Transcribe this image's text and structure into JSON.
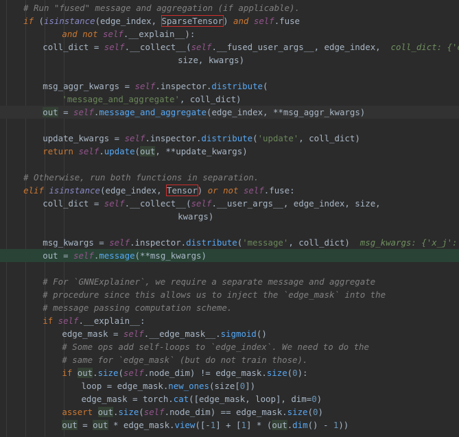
{
  "editor": {
    "language": "Python",
    "theme_colors": {
      "background": "#2b2b2b",
      "keyword": "#cc7832",
      "comment": "#808080",
      "string": "#6a8759",
      "self": "#94558d",
      "method": "#56a8f5",
      "number": "#6897bb",
      "highlight_box": "#d42e2e",
      "current_line": "#294436"
    },
    "lines": [
      {
        "indent": 4,
        "bg": "",
        "tokens": [
          [
            "cmt",
            "# Run \"fused\" message and aggregation (if applicable)."
          ]
        ]
      },
      {
        "indent": 4,
        "bg": "",
        "tokens": [
          [
            "kw",
            "if"
          ],
          [
            "p",
            " ("
          ],
          [
            "bi",
            "isinstance"
          ],
          [
            "p",
            "(edge_index, "
          ],
          [
            "box",
            "SparseTensor"
          ],
          [
            "p",
            ") "
          ],
          [
            "kw",
            "and"
          ],
          [
            "p",
            " "
          ],
          [
            "slf",
            "self"
          ],
          [
            "p",
            ".fuse"
          ]
        ]
      },
      {
        "indent": 12,
        "bg": "",
        "tokens": [
          [
            "kw",
            "and not"
          ],
          [
            "p",
            " "
          ],
          [
            "slf",
            "self"
          ],
          [
            "p",
            ".__explain__):"
          ]
        ]
      },
      {
        "indent": 8,
        "bg": "",
        "tokens": [
          [
            "p",
            "coll_dict = "
          ],
          [
            "slf",
            "self"
          ],
          [
            "p",
            ".__collect__("
          ],
          [
            "slf",
            "self"
          ],
          [
            "p",
            ".__fused_user_args__, edge_index,  "
          ],
          [
            "hint",
            "coll_dict: {'edge_w"
          ]
        ]
      },
      {
        "indent": 36,
        "bg": "",
        "tokens": [
          [
            "p",
            "size, kwargs)"
          ]
        ]
      },
      {
        "indent": 0,
        "bg": "",
        "tokens": []
      },
      {
        "indent": 8,
        "bg": "",
        "tokens": [
          [
            "p",
            "msg_aggr_kwargs = "
          ],
          [
            "slf",
            "self"
          ],
          [
            "p",
            ".inspector."
          ],
          [
            "mth",
            "distribute"
          ],
          [
            "p",
            "("
          ]
        ]
      },
      {
        "indent": 12,
        "bg": "",
        "tokens": [
          [
            "str",
            "'message_and_aggregate'"
          ],
          [
            "p",
            ", coll_dict)"
          ]
        ]
      },
      {
        "indent": 8,
        "bg": "gray",
        "tokens": [
          [
            "ref",
            "out"
          ],
          [
            "p",
            " = "
          ],
          [
            "slf",
            "self"
          ],
          [
            "p",
            "."
          ],
          [
            "mth",
            "message_and_aggregate"
          ],
          [
            "p",
            "(edge_index, **msg_aggr_kwargs)"
          ]
        ]
      },
      {
        "indent": 0,
        "bg": "",
        "tokens": []
      },
      {
        "indent": 8,
        "bg": "",
        "tokens": [
          [
            "p",
            "update_kwargs = "
          ],
          [
            "slf",
            "self"
          ],
          [
            "p",
            ".inspector."
          ],
          [
            "mth",
            "distribute"
          ],
          [
            "p",
            "("
          ],
          [
            "str",
            "'update'"
          ],
          [
            "p",
            ", coll_dict)"
          ]
        ]
      },
      {
        "indent": 8,
        "bg": "",
        "tokens": [
          [
            "kwn",
            "return"
          ],
          [
            "p",
            " "
          ],
          [
            "slf",
            "self"
          ],
          [
            "p",
            "."
          ],
          [
            "mth",
            "update"
          ],
          [
            "p",
            "("
          ],
          [
            "ref",
            "out"
          ],
          [
            "p",
            ", **update_kwargs)"
          ]
        ]
      },
      {
        "indent": 0,
        "bg": "",
        "tokens": []
      },
      {
        "indent": 4,
        "bg": "",
        "tokens": [
          [
            "cmt",
            "# Otherwise, run both functions in separation."
          ]
        ]
      },
      {
        "indent": 4,
        "bg": "",
        "tokens": [
          [
            "kw",
            "elif"
          ],
          [
            "p",
            " "
          ],
          [
            "bi",
            "isinstance"
          ],
          [
            "p",
            "(edge_index, "
          ],
          [
            "box",
            "Tensor"
          ],
          [
            "p",
            ") "
          ],
          [
            "kw",
            "or not"
          ],
          [
            "p",
            " "
          ],
          [
            "slf",
            "self"
          ],
          [
            "p",
            ".fuse:"
          ]
        ]
      },
      {
        "indent": 8,
        "bg": "",
        "tokens": [
          [
            "p",
            "coll_dict = "
          ],
          [
            "slf",
            "self"
          ],
          [
            "p",
            ".__collect__("
          ],
          [
            "slf",
            "self"
          ],
          [
            "p",
            ".__user_args__, edge_index, size,"
          ]
        ]
      },
      {
        "indent": 36,
        "bg": "",
        "tokens": [
          [
            "p",
            "kwargs)"
          ]
        ]
      },
      {
        "indent": 0,
        "bg": "",
        "tokens": []
      },
      {
        "indent": 8,
        "bg": "",
        "tokens": [
          [
            "p",
            "msg_kwargs = "
          ],
          [
            "slf",
            "self"
          ],
          [
            "p",
            ".inspector."
          ],
          [
            "mth",
            "distribute"
          ],
          [
            "p",
            "("
          ],
          [
            "str",
            "'message'"
          ],
          [
            "p",
            ", coll_dict)  "
          ],
          [
            "hint",
            "msg_kwargs: {'x_j': tenso"
          ]
        ]
      },
      {
        "indent": 8,
        "bg": "green",
        "tokens": [
          [
            "p",
            "out = "
          ],
          [
            "slf",
            "self"
          ],
          [
            "p",
            "."
          ],
          [
            "mth",
            "message"
          ],
          [
            "p",
            "(**msg_kwargs)"
          ]
        ]
      },
      {
        "indent": 0,
        "bg": "",
        "tokens": []
      },
      {
        "indent": 8,
        "bg": "",
        "tokens": [
          [
            "cmt",
            "# For `GNNExplainer`, we require a separate message and aggregate"
          ]
        ]
      },
      {
        "indent": 8,
        "bg": "",
        "tokens": [
          [
            "cmt",
            "# procedure since this allows us to inject the `edge_mask` into the"
          ]
        ]
      },
      {
        "indent": 8,
        "bg": "",
        "tokens": [
          [
            "cmt",
            "# message passing computation scheme."
          ]
        ]
      },
      {
        "indent": 8,
        "bg": "",
        "tokens": [
          [
            "kwn",
            "if"
          ],
          [
            "p",
            " "
          ],
          [
            "slf",
            "self"
          ],
          [
            "p",
            ".__explain__:"
          ]
        ]
      },
      {
        "indent": 12,
        "bg": "",
        "tokens": [
          [
            "p",
            "edge_mask = "
          ],
          [
            "slf",
            "self"
          ],
          [
            "p",
            ".__edge_mask__."
          ],
          [
            "mth",
            "sigmoid"
          ],
          [
            "p",
            "()"
          ]
        ]
      },
      {
        "indent": 12,
        "bg": "",
        "tokens": [
          [
            "cmt",
            "# Some ops add self-loops to `edge_index`. We need to do the"
          ]
        ]
      },
      {
        "indent": 12,
        "bg": "",
        "tokens": [
          [
            "cmt",
            "# same for `edge_mask` (but do not train those)."
          ]
        ]
      },
      {
        "indent": 12,
        "bg": "",
        "tokens": [
          [
            "kwn",
            "if"
          ],
          [
            "p",
            " "
          ],
          [
            "ref",
            "out"
          ],
          [
            "p",
            "."
          ],
          [
            "mth",
            "size"
          ],
          [
            "p",
            "("
          ],
          [
            "slf",
            "self"
          ],
          [
            "p",
            ".node_dim) != edge_mask."
          ],
          [
            "mth",
            "size"
          ],
          [
            "p",
            "("
          ],
          [
            "num",
            "0"
          ],
          [
            "p",
            "):"
          ]
        ]
      },
      {
        "indent": 16,
        "bg": "",
        "tokens": [
          [
            "p",
            "loop = edge_mask."
          ],
          [
            "mth",
            "new_ones"
          ],
          [
            "p",
            "(size["
          ],
          [
            "num",
            "0"
          ],
          [
            "p",
            "])"
          ]
        ]
      },
      {
        "indent": 16,
        "bg": "",
        "tokens": [
          [
            "p",
            "edge_mask = torch."
          ],
          [
            "mth",
            "cat"
          ],
          [
            "p",
            "([edge_mask, loop], dim="
          ],
          [
            "num",
            "0"
          ],
          [
            "p",
            ")"
          ]
        ]
      },
      {
        "indent": 12,
        "bg": "",
        "tokens": [
          [
            "kwn",
            "assert"
          ],
          [
            "p",
            " "
          ],
          [
            "ref",
            "out"
          ],
          [
            "p",
            "."
          ],
          [
            "mth",
            "size"
          ],
          [
            "p",
            "("
          ],
          [
            "slf",
            "self"
          ],
          [
            "p",
            ".node_dim) == edge_mask."
          ],
          [
            "mth",
            "size"
          ],
          [
            "p",
            "("
          ],
          [
            "num",
            "0"
          ],
          [
            "p",
            ")"
          ]
        ]
      },
      {
        "indent": 12,
        "bg": "",
        "tokens": [
          [
            "ref",
            "out"
          ],
          [
            "p",
            " = "
          ],
          [
            "ref",
            "out"
          ],
          [
            "p",
            " * edge_mask."
          ],
          [
            "mth",
            "view"
          ],
          [
            "p",
            "([-"
          ],
          [
            "num",
            "1"
          ],
          [
            "p",
            "] + ["
          ],
          [
            "num",
            "1"
          ],
          [
            "p",
            "] * ("
          ],
          [
            "ref",
            "out"
          ],
          [
            "p",
            "."
          ],
          [
            "mth",
            "dim"
          ],
          [
            "p",
            "() - "
          ],
          [
            "num",
            "1"
          ],
          [
            "p",
            "))"
          ]
        ]
      }
    ]
  }
}
